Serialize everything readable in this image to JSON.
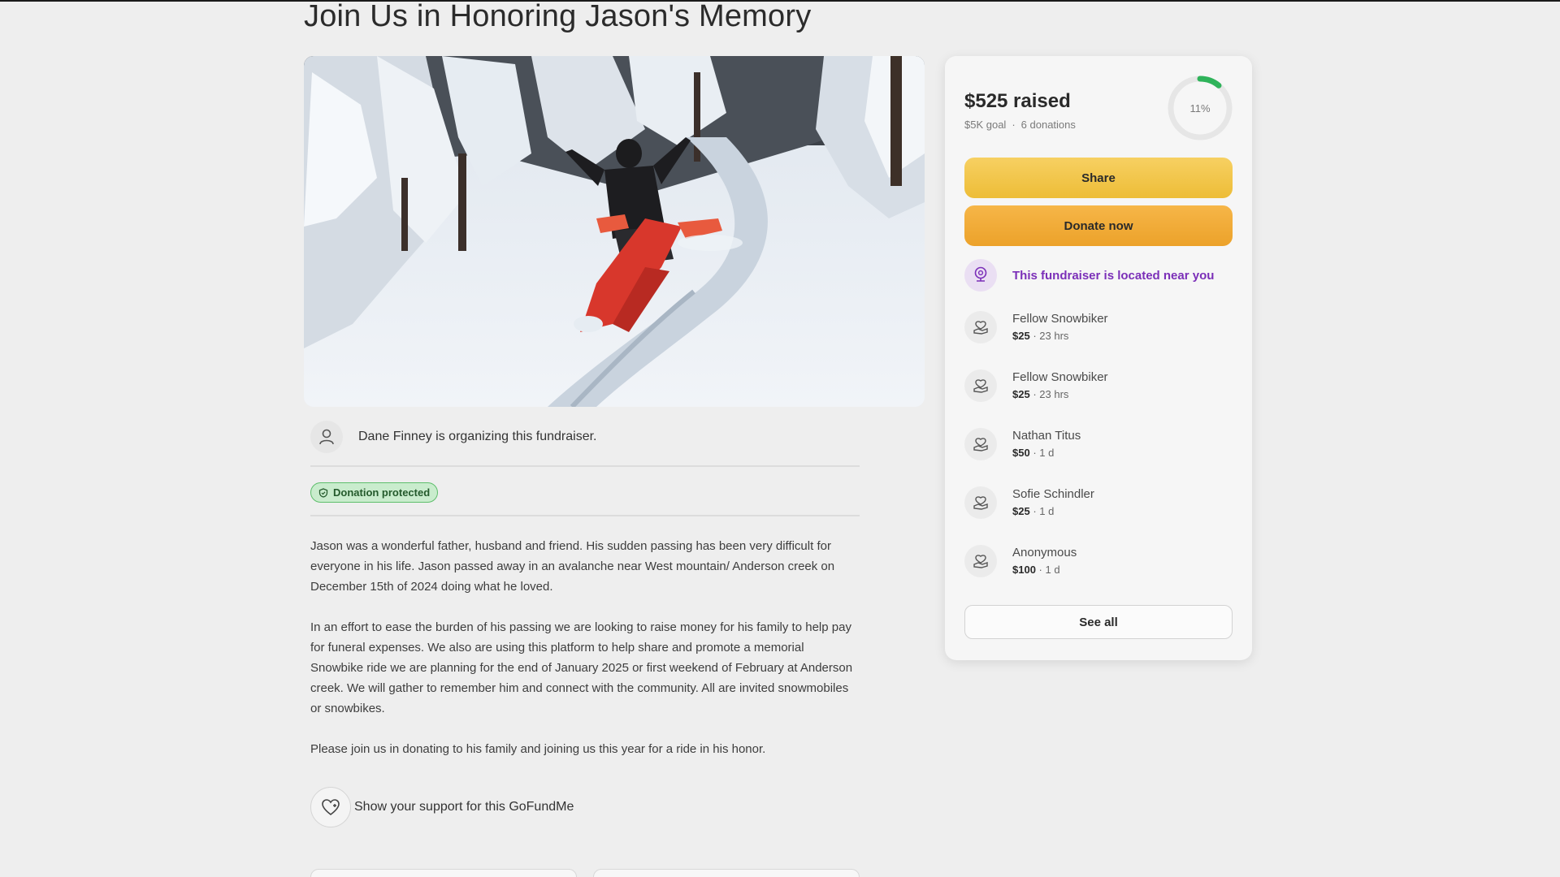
{
  "page": {
    "title": "Join Us in Honoring Jason's Memory"
  },
  "organizer": {
    "text": "Dane Finney is organizing this fundraiser.",
    "icon": "person-icon"
  },
  "badge": {
    "label": "Donation protected",
    "icon": "shield-icon"
  },
  "story": [
    "Jason was a wonderful father, husband and friend. His sudden passing has been very difficult for everyone in his life. Jason passed away in an avalanche near West mountain/ Anderson creek on December 15th of 2024 doing what he loved.",
    "In an effort to ease the burden of his passing we are looking to raise money for his family to help pay for funeral expenses. We also are using this platform to help share and promote a memorial Snowbike ride we are planning for the end of January 2025 or first weekend of February at Anderson creek. We will gather to remember him and connect with the community. All are invited snowmobiles or snowbikes.",
    "Please join us in donating to his family and joining us this year for a ride in his honor."
  ],
  "support": {
    "text": "Show your support for this GoFundMe",
    "icon": "heart-icon"
  },
  "sidebar": {
    "raised": "$525 raised",
    "goal": "$5K goal",
    "donations": "6 donations",
    "progress_label": "11%",
    "progress_fraction": 0.11,
    "share_label": "Share",
    "donate_label": "Donate now",
    "near_text": "This fundraiser is located near you",
    "see_all_label": "See all",
    "donors": [
      {
        "name": "Fellow Snowbiker",
        "amount": "$25",
        "time": "23 hrs"
      },
      {
        "name": "Fellow Snowbiker",
        "amount": "$25",
        "time": "23 hrs"
      },
      {
        "name": "Nathan Titus",
        "amount": "$50",
        "time": "1 d"
      },
      {
        "name": "Sofie Schindler",
        "amount": "$25",
        "time": "1 d"
      },
      {
        "name": "Anonymous",
        "amount": "$100",
        "time": "1 d"
      }
    ]
  },
  "colors": {
    "share_button": "#f2c84b",
    "donate_button": "#f0ab35",
    "progress_green": "#2fb35a",
    "near_purple": "#7b2fb8",
    "badge_green": "#c9eccd"
  }
}
